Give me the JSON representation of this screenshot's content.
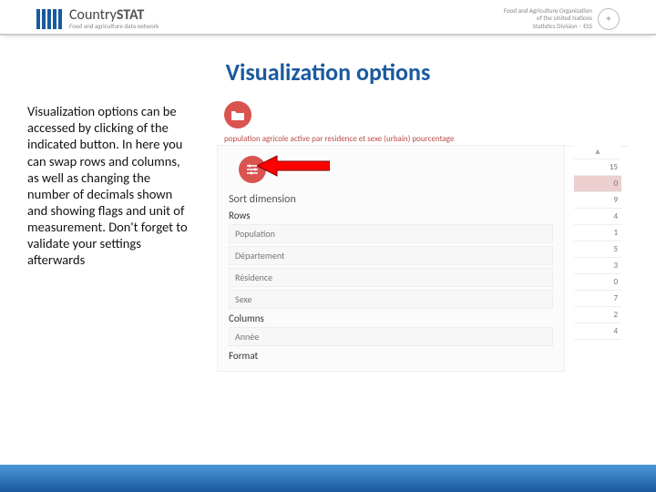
{
  "header": {
    "brand_main": "Country",
    "brand_strong": "STAT",
    "brand_sub": "Food and agriculture data network",
    "fao_line1": "Food and Agriculture Organization",
    "fao_line2": "of the United Nations",
    "fao_line3": "Statistics Division – ESS"
  },
  "title": "Visualization options",
  "body_text": "Visualization options can be accessed by clicking of the indicated button. In here you can swap rows and columns, as well as changing the number of decimals shown and showing flags and unit of measurement. Don't forget to validate your settings afterwards",
  "panel": {
    "domain_label": "population agricole active par residence et sexe (urbain) pourcentage",
    "sort_label": "Sort dimension",
    "rows_label": "Rows",
    "rows_items": [
      "Population",
      "Département",
      "Résidence",
      "Sexe"
    ],
    "cols_label": "Columns",
    "cols_items": [
      "Année"
    ],
    "format_label": "Format",
    "year_header": "15",
    "side_values": [
      "0",
      "9",
      "4",
      "1",
      "5",
      "3",
      "0",
      "7",
      "2",
      "4"
    ]
  }
}
